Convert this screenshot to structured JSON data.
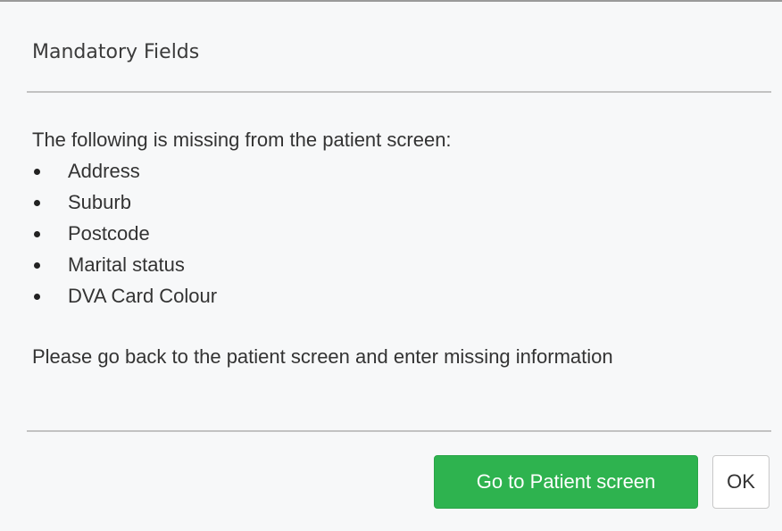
{
  "dialog": {
    "title": "Mandatory Fields",
    "intro": "The following is missing from the patient screen:",
    "missing_items": [
      "Address",
      "Suburb",
      "Postcode",
      "Marital status",
      "DVA Card Colour"
    ],
    "instruction": "Please go back to the patient screen and enter missing information",
    "buttons": {
      "go_to_patient": "Go to Patient screen",
      "ok": "OK"
    },
    "colors": {
      "primary_button": "#2eb34f",
      "primary_text": "#ffffff",
      "secondary_button": "#ffffff",
      "divider": "#c2c2c2"
    }
  }
}
